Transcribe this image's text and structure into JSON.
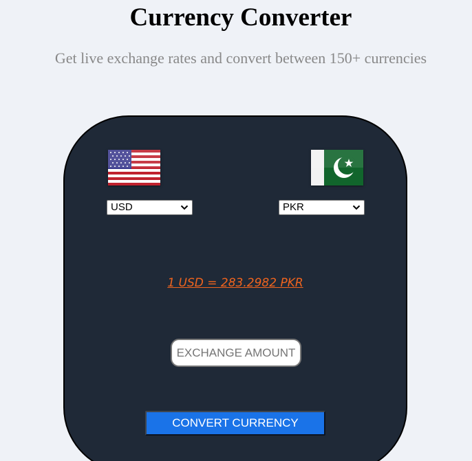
{
  "header": {
    "title": "Currency Converter",
    "subtitle": "Get live exchange rates and convert between 150+ currencies"
  },
  "converter": {
    "from": {
      "currency": "USD",
      "flag_icon": "us-flag-icon"
    },
    "to": {
      "currency": "PKR",
      "flag_icon": "pk-flag-icon"
    },
    "rate_text": "1 USD = 283.2982 PKR",
    "amount_placeholder": "EXCHANGE AMOUNT",
    "convert_label": "CONVERT CURRENCY"
  },
  "colors": {
    "page_background": "#eff2f7",
    "card_background": "#1f2937",
    "rate_text": "#f0641e",
    "button_background": "#1a73e8"
  }
}
